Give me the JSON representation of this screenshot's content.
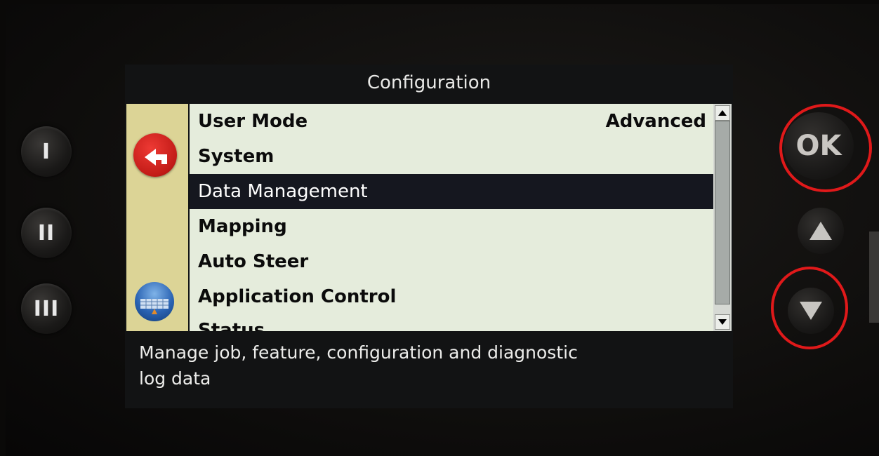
{
  "screen": {
    "title": "Configuration",
    "menu_items": [
      {
        "label": "User Mode",
        "value": "Advanced",
        "selected": false
      },
      {
        "label": "System",
        "value": "",
        "selected": false
      },
      {
        "label": "Data Management",
        "value": "",
        "selected": true
      },
      {
        "label": "Mapping",
        "value": "",
        "selected": false
      },
      {
        "label": "Auto Steer",
        "value": "",
        "selected": false
      },
      {
        "label": "Application Control",
        "value": "",
        "selected": false
      },
      {
        "label": "Status",
        "value": "",
        "selected": false
      }
    ],
    "description": "Manage job, feature, configuration and diagnostic\nlog data"
  },
  "hardware": {
    "side_buttons": [
      "I",
      "II",
      "III"
    ],
    "ok_label": "OK"
  },
  "icons": {
    "back": "back-arrow-icon",
    "application": "application-control-icon"
  },
  "colors": {
    "highlight": "#15171f",
    "list_bg": "#e5ecdc",
    "left_bar": "#dcd496",
    "annotation_ring": "#e0191a"
  }
}
